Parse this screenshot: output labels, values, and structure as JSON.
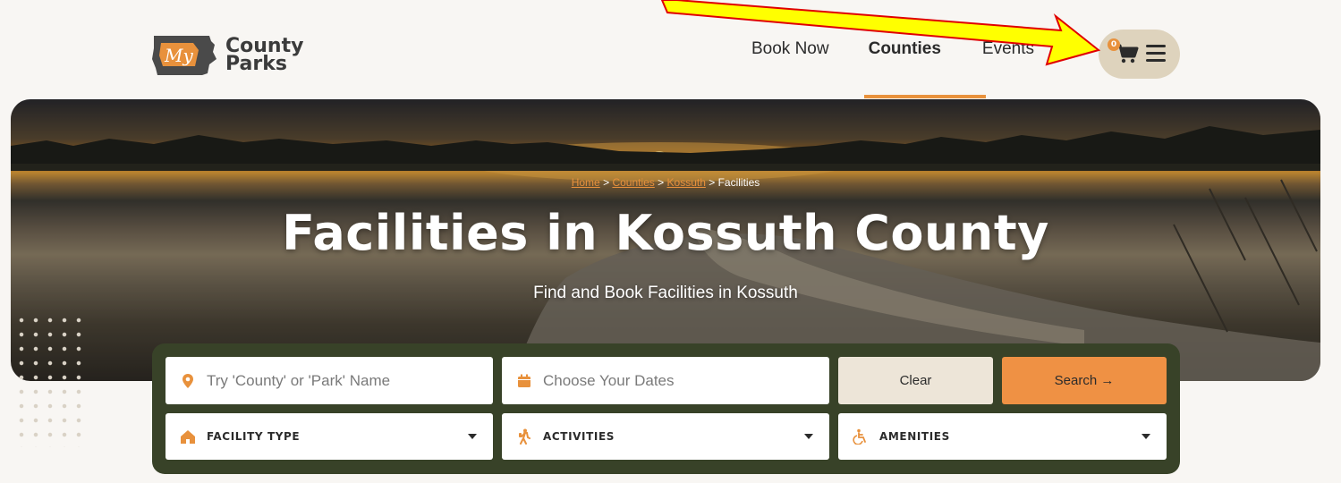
{
  "brand": {
    "logo_line1": "County",
    "logo_line2": "Parks",
    "logo_mark": "My"
  },
  "nav": {
    "items": [
      {
        "label": "Book Now",
        "active": false
      },
      {
        "label": "Counties",
        "active": true
      },
      {
        "label": "Events",
        "active": false
      }
    ],
    "cart_count": "0",
    "cart_icon": "cart-icon",
    "menu_icon": "hamburger-menu-icon"
  },
  "hero": {
    "breadcrumb": [
      {
        "label": "Home",
        "link": true
      },
      {
        "label": "Counties",
        "link": true
      },
      {
        "label": "Kossuth",
        "link": true
      },
      {
        "label": "Facilities",
        "link": false
      }
    ],
    "breadcrumb_separator": ">",
    "title": "Facilities in Kossuth County",
    "subtitle": "Find and Book Facilities in Kossuth"
  },
  "search": {
    "location_placeholder": "Try 'County' or 'Park' Name",
    "dates_placeholder": "Choose Your Dates",
    "clear_label": "Clear",
    "search_label": "Search →",
    "filters": [
      {
        "label": "FACILITY TYPE",
        "icon": "house-icon"
      },
      {
        "label": "ACTIVITIES",
        "icon": "hiker-icon"
      },
      {
        "label": "AMENITIES",
        "icon": "wheelchair-icon"
      }
    ]
  },
  "colors": {
    "accent": "#e8913c",
    "panel": "#384228",
    "cart_pill": "#ded3bd",
    "background": "#f8f6f3",
    "annotation_arrow": "#ffff00"
  }
}
